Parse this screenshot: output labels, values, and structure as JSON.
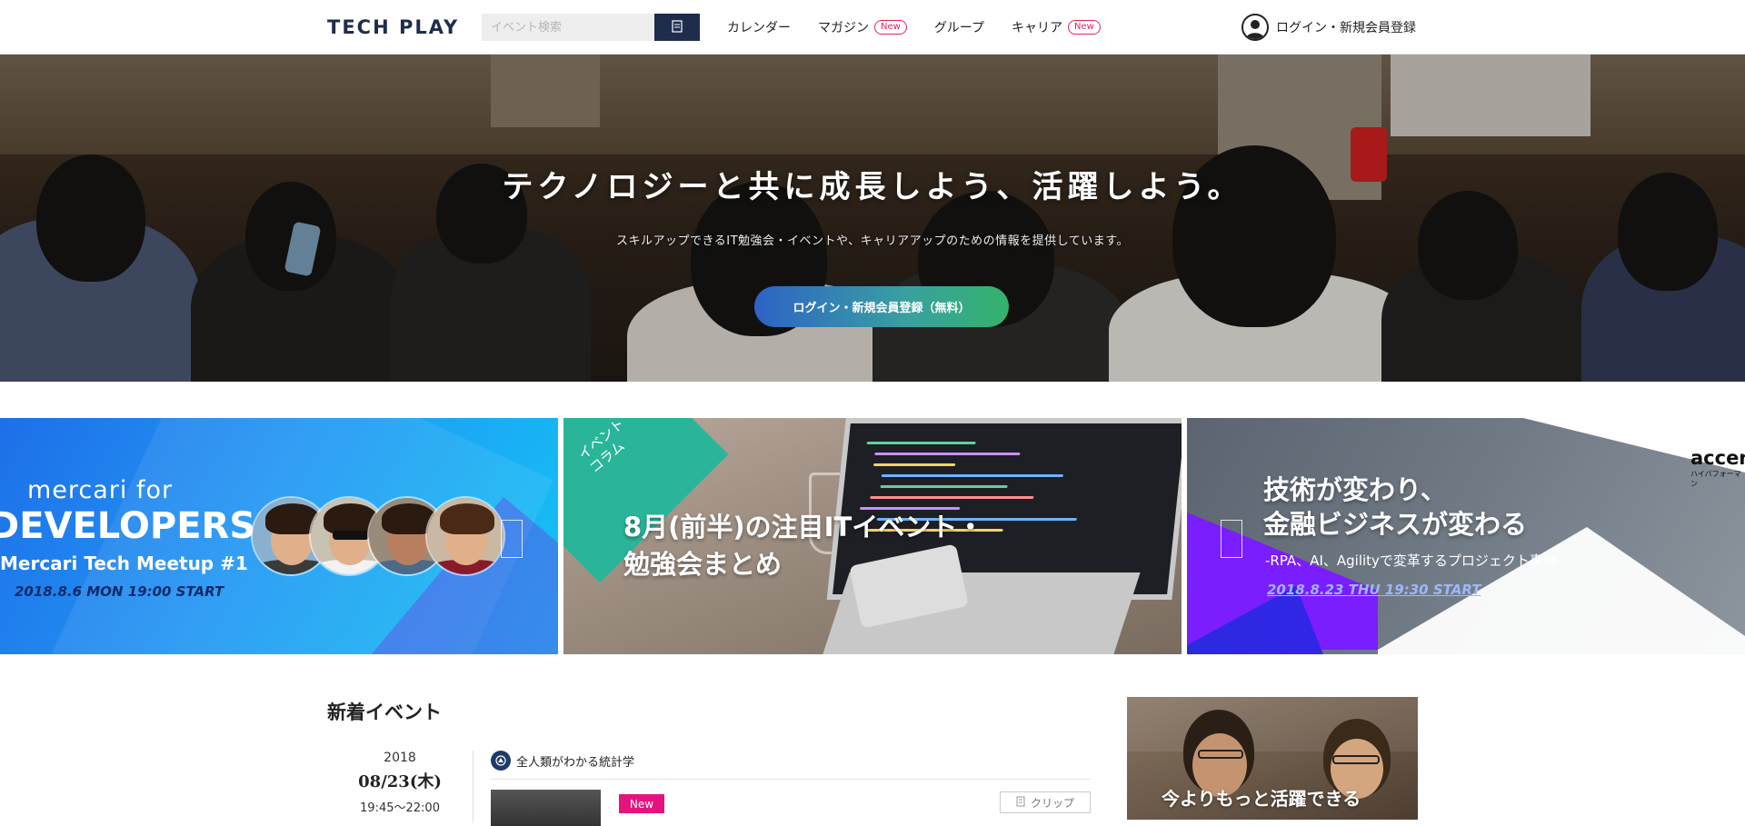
{
  "header": {
    "logo": "TECH PLAY",
    "search_placeholder": "イベント検索",
    "nav": [
      {
        "label": "カレンダー",
        "badge": ""
      },
      {
        "label": "マガジン",
        "badge": "New"
      },
      {
        "label": "グループ",
        "badge": ""
      },
      {
        "label": "キャリア",
        "badge": "New"
      }
    ],
    "login_label": "ログイン・新規会員登録"
  },
  "hero": {
    "title": "テクノロジーと共に成長しよう、活躍しよう。",
    "subtitle": "スキルアップできるIT勉強会・イベントや、キャリアアップのための情報を提供しています。",
    "cta": "ログイン・新規会員登録（無料）"
  },
  "banners": {
    "mercari": {
      "line1": "mercari for",
      "line2": "DEVELOPERS",
      "line3": "Mercari Tech Meetup #1",
      "date": "2018.8.6 MON 19:00 START"
    },
    "column": {
      "ribbon": "イベント\nコラム",
      "title_line1": "8月(前半)の注目ITイベント・",
      "title_line2": "勉強会まとめ"
    },
    "accenture": {
      "title_line1": "技術が変わり、",
      "title_line2": "金融ビジネスが変わる",
      "subtitle": "-RPA、AI、Agilityで変革するプロジェクト事例-",
      "date": "2018.8.23 THU 19:30 START",
      "logo": "accent",
      "logo_sub": "ハイパフォーマン"
    }
  },
  "new_events": {
    "section_title": "新着イベント",
    "event": {
      "year": "2018",
      "day": "08/23(木)",
      "time": "19:45〜22:00",
      "group": "全人類がわかる統計学",
      "badge": "New",
      "clip_label": "クリップ"
    }
  },
  "side_ad": {
    "title": "今よりもっと活躍できる"
  },
  "colors": {
    "brand_navy": "#1f2d4d",
    "new_pink": "#e0245e",
    "event_new": "#e4147f",
    "accent_purple": "#7a1dff"
  }
}
